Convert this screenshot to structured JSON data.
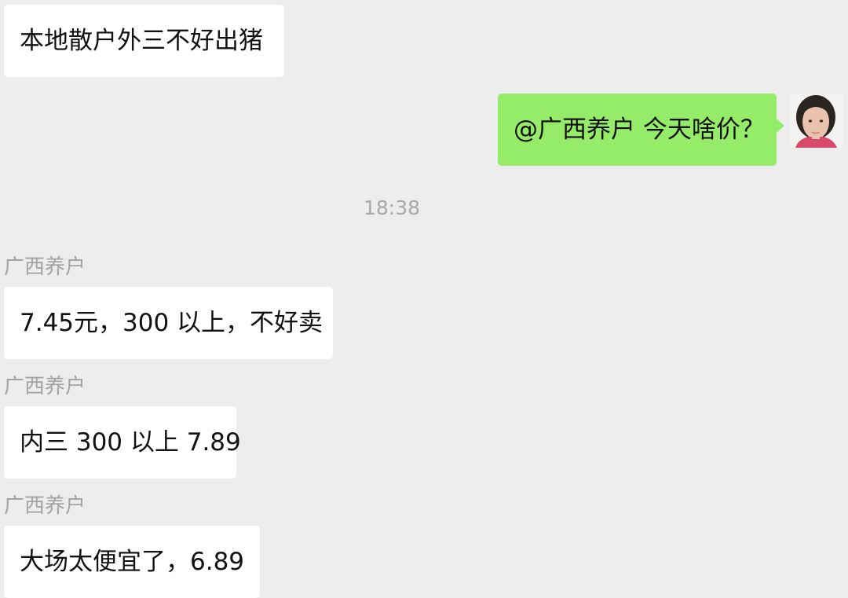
{
  "messages": [
    {
      "text": "本地散户外三不好出猪"
    },
    {
      "text": "@广西养户 今天啥价？"
    },
    {
      "sender": "广西养户",
      "text": "7.45元，300 以上，不好卖"
    },
    {
      "sender": "广西养户",
      "text": "内三 300 以上 7.89"
    },
    {
      "sender": "广西养户",
      "text": "大场太便宜了，6.89"
    }
  ],
  "timestamp": "18:38",
  "colors": {
    "background": "#ededed",
    "incoming_bubble": "#ffffff",
    "outgoing_bubble": "#95ec69",
    "secondary_text": "#a2a2a2"
  },
  "icons": {
    "avatar": "user-avatar-photo"
  }
}
